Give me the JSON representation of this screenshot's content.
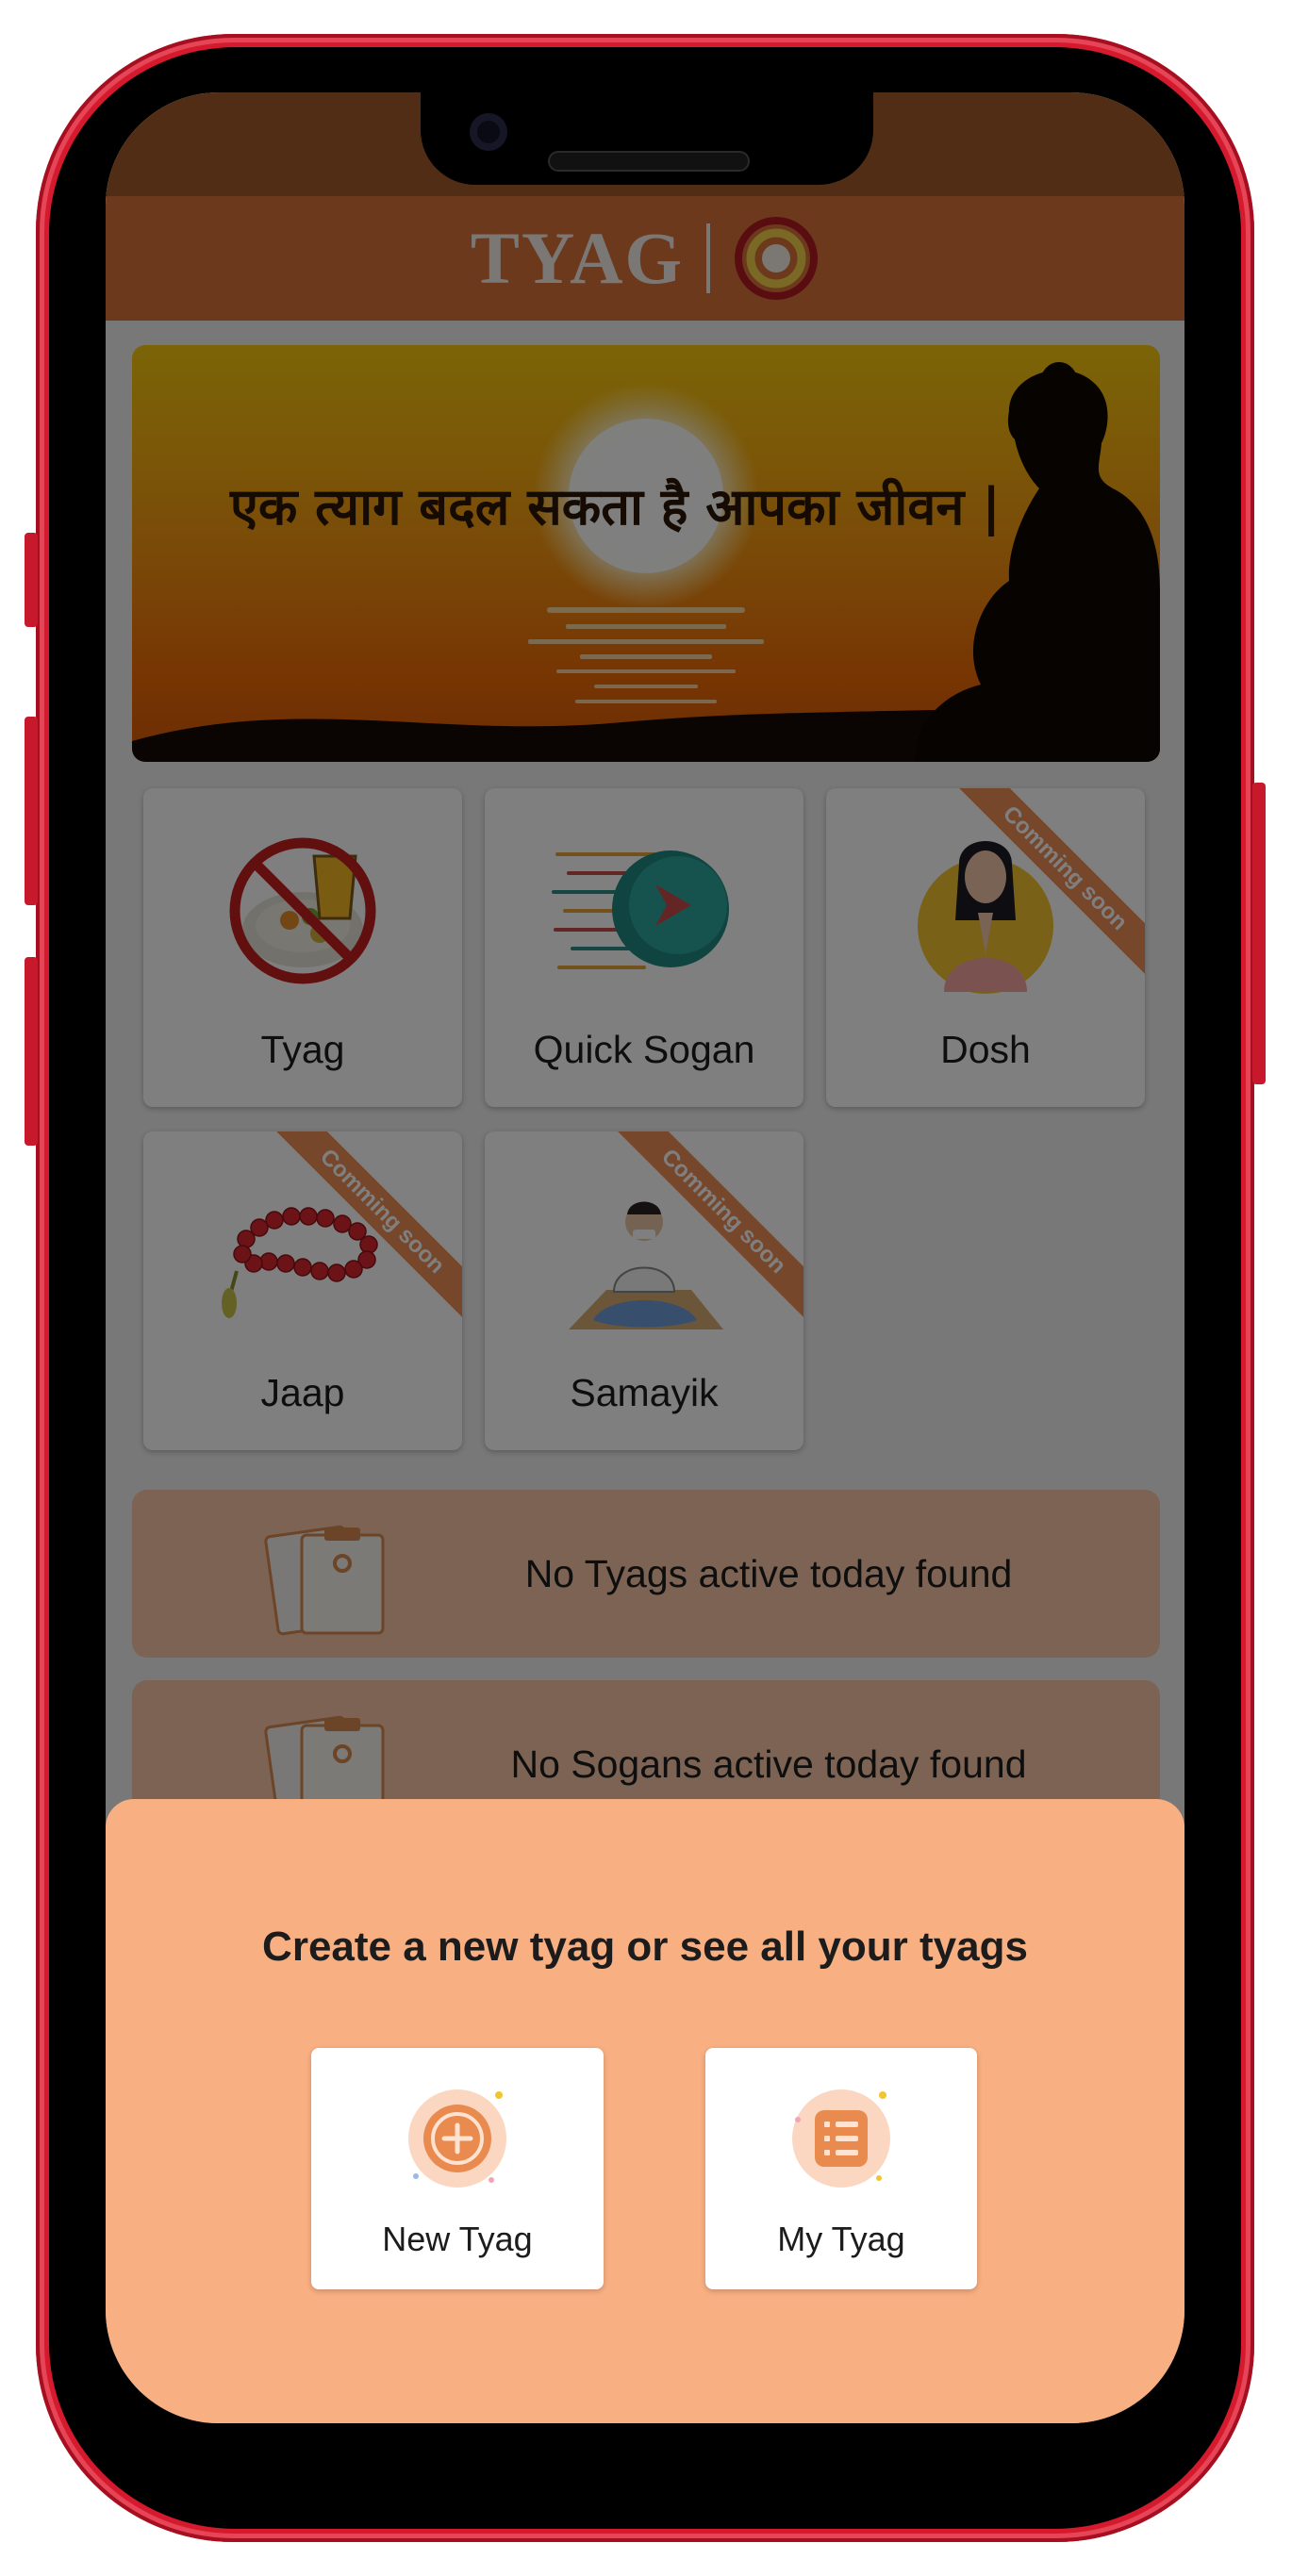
{
  "app": {
    "name": "TYAG",
    "colors": {
      "header": "#d9733b",
      "accent": "#ee8f56",
      "sheet": "#f8af82",
      "info_row": "#f8c6a6"
    }
  },
  "banner": {
    "text": "एक त्याग बदल सकता है आपका जीवन |"
  },
  "features": [
    {
      "label": "Tyag",
      "icon": "no-food-icon",
      "coming_soon": false
    },
    {
      "label": "Quick Sogan",
      "icon": "fast-forward-icon",
      "coming_soon": false
    },
    {
      "label": "Dosh",
      "icon": "praying-person-icon",
      "coming_soon": true,
      "ribbon": "Comming soon"
    },
    {
      "label": "Jaap",
      "icon": "prayer-beads-icon",
      "coming_soon": true,
      "ribbon": "Comming soon"
    },
    {
      "label": "Samayik",
      "icon": "meditating-person-icon",
      "coming_soon": true,
      "ribbon": "Comming soon"
    }
  ],
  "status_rows": [
    {
      "text": "No Tyags active today found",
      "icon": "clipboard-icon"
    },
    {
      "text": "No Sogans active today found",
      "icon": "clipboard-icon"
    }
  ],
  "bottom_sheet": {
    "title": "Create a new tyag or see all your tyags",
    "actions": [
      {
        "label": "New Tyag",
        "icon": "add-circle-icon"
      },
      {
        "label": "My Tyag",
        "icon": "list-icon"
      }
    ]
  }
}
